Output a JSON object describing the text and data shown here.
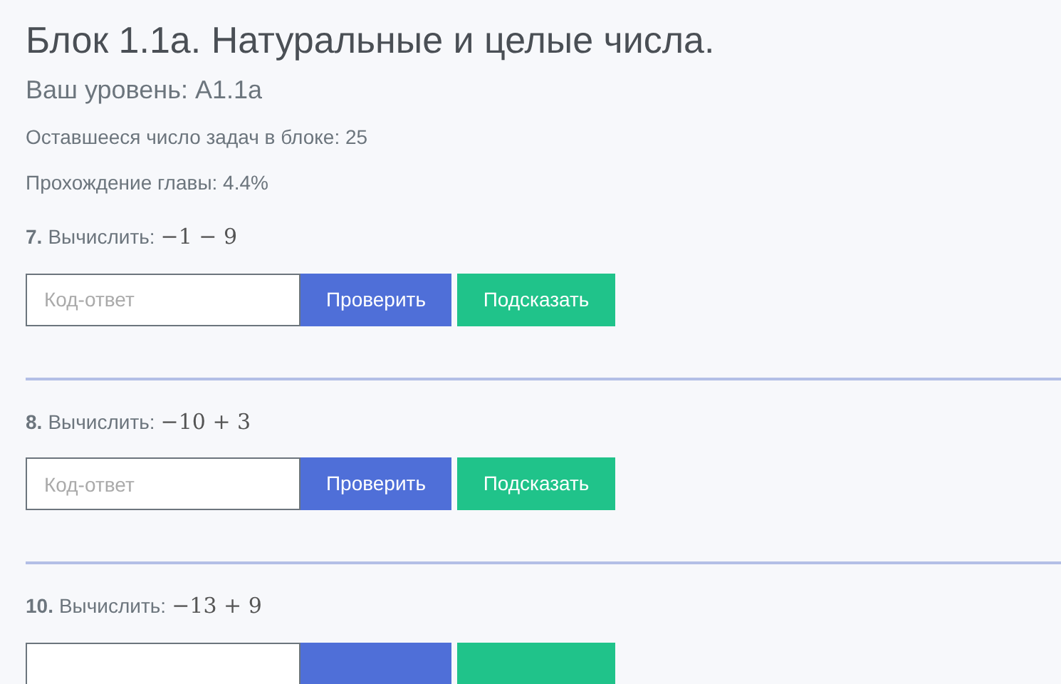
{
  "title": "Блок 1.1а. Натуральные и целые числа.",
  "level_label": "Ваш уровень: A1.1a",
  "remaining": "Оставшееся число задач в блоке: 25",
  "progress": "Прохождение главы: 4.4%",
  "problems": [
    {
      "number": "7.",
      "prompt": "Вычислить:",
      "expression": "−1 − 9",
      "placeholder": "Код-ответ",
      "check": "Проверить",
      "hint": "Подсказать"
    },
    {
      "number": "8.",
      "prompt": "Вычислить:",
      "expression": "−10 + 3",
      "placeholder": "Код-ответ",
      "check": "Проверить",
      "hint": "Подсказать"
    },
    {
      "number": "10.",
      "prompt": "Вычислить:",
      "expression": "−13 + 9"
    }
  ]
}
